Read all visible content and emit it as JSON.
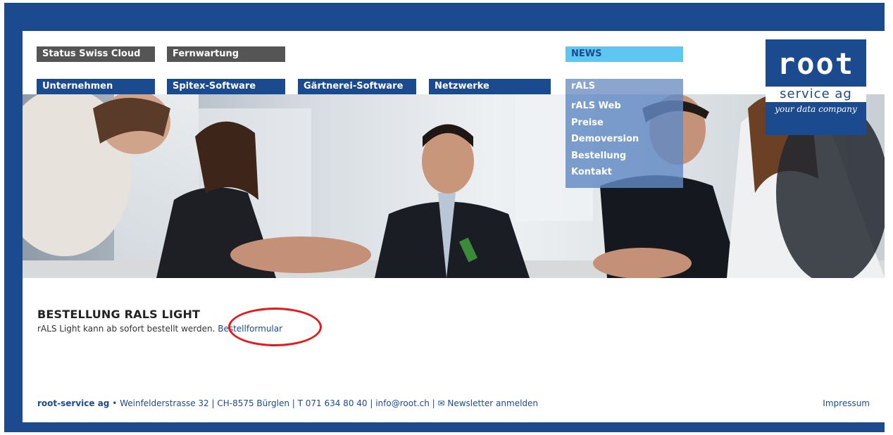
{
  "nav": {
    "top_row": [
      {
        "label": "Status Swiss Cloud"
      },
      {
        "label": "Fernwartung"
      },
      {
        "label": "NEWS"
      }
    ],
    "main_row": [
      {
        "label": "Unternehmen"
      },
      {
        "label": "Spitex-Software"
      },
      {
        "label": "Gärtnerei-Software"
      },
      {
        "label": "Netzwerke"
      },
      {
        "label": "rALS"
      }
    ],
    "submenu": [
      {
        "label": "rALS Web"
      },
      {
        "label": "Preise"
      },
      {
        "label": "Demoversion"
      },
      {
        "label": "Bestellung"
      },
      {
        "label": "Kontakt"
      }
    ]
  },
  "logo": {
    "wordmark": "root",
    "subtitle": "service ag",
    "tagline": "your data company"
  },
  "content": {
    "title": "BESTELLUNG RALS LIGHT",
    "text": "rALS Light kann ab sofort bestellt werden. ",
    "link": "Bestellformular"
  },
  "footer": {
    "company": "root-service ag",
    "separator": " • ",
    "address": "Weinfelderstrasse 32 | CH-8575 Bürglen | T 071 634 80 40 | ",
    "email": "info@root.ch",
    "pipe": " | ",
    "newsletter_icon": "✉",
    "newsletter": "Newsletter anmelden",
    "impressum": "Impressum"
  },
  "colors": {
    "brand_blue": "#1c4a8f",
    "nav_gray": "#555555",
    "news_cyan": "#5ec6ef",
    "highlight_red": "#e31b1b"
  },
  "icons": {
    "newsletter": "envelope-icon"
  }
}
